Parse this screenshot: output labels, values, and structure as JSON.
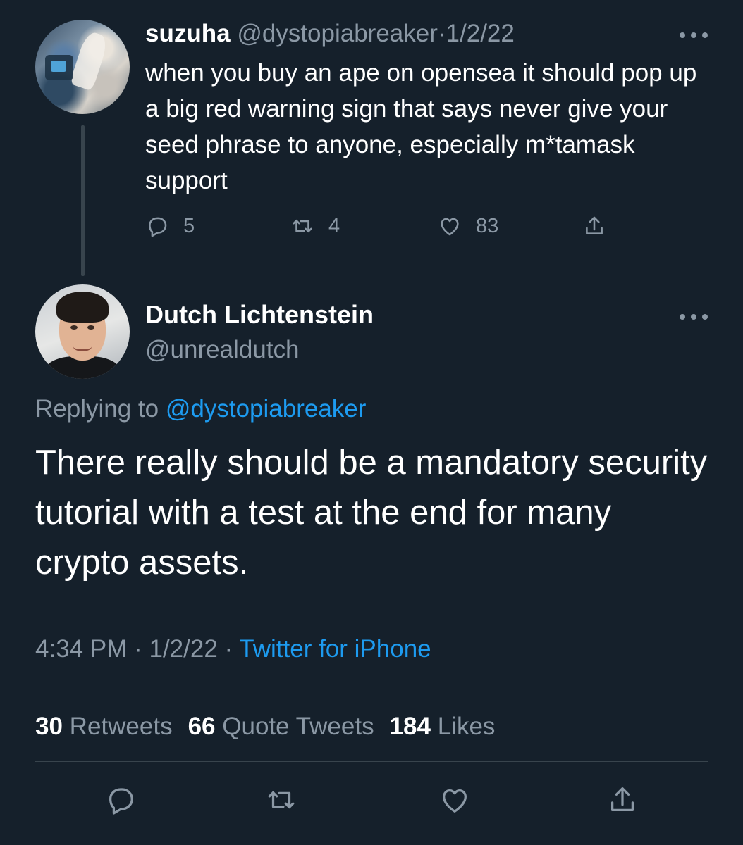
{
  "parent_tweet": {
    "author_name": "suzuha",
    "author_handle": "@dystopiabreaker",
    "separator": "·",
    "date": "1/2/22",
    "text": "when you buy an ape on opensea it should pop up a big red warning sign that says never give your seed phrase to anyone, especially m*tamask support",
    "replies": "5",
    "retweets": "4",
    "likes": "83",
    "icons": [
      "reply-icon",
      "retweet-icon",
      "like-icon",
      "share-icon",
      "more-icon"
    ]
  },
  "main_tweet": {
    "author_name": "Dutch Lichtenstein",
    "author_handle": "@unrealdutch",
    "replying_prefix": "Replying to",
    "replying_handle": "@dystopiabreaker",
    "text": "There really should be a mandatory security tutorial with a test at the end for many crypto assets.",
    "time": "4:34 PM",
    "separator": "·",
    "date": "1/2/22",
    "source": "Twitter for iPhone",
    "stats": {
      "retweets_count": "30",
      "retweets_label": "Retweets",
      "quotes_count": "66",
      "quotes_label": "Quote Tweets",
      "likes_count": "184",
      "likes_label": "Likes"
    }
  },
  "colors": {
    "background": "#15202b",
    "text": "#ffffff",
    "muted": "#8b98a5",
    "link": "#1d9bf0",
    "divider": "#38444d"
  }
}
